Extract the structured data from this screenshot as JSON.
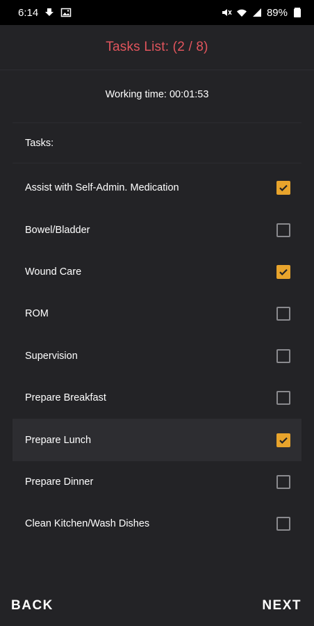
{
  "status_bar": {
    "time": "6:14",
    "battery": "89%",
    "icons_left": [
      "download-icon",
      "image-icon"
    ],
    "icons_right": [
      "mute-icon",
      "wifi-icon",
      "signal-icon",
      "battery-icon"
    ]
  },
  "header": {
    "title": "Tasks List: (2 / 8)",
    "title_color": "#e2555d"
  },
  "working_time": "Working time: 00:01:53",
  "tasks_label": "Tasks:",
  "accent_color": "#e8a42c",
  "tasks": [
    {
      "label": "Assist with Self-Admin. Medication",
      "checked": true
    },
    {
      "label": "Bowel/Bladder",
      "checked": false
    },
    {
      "label": "Wound Care",
      "checked": true
    },
    {
      "label": "ROM",
      "checked": false
    },
    {
      "label": "Supervision",
      "checked": false
    },
    {
      "label": "Prepare Breakfast",
      "checked": false
    },
    {
      "label": "Prepare Lunch",
      "checked": true,
      "highlighted": true
    },
    {
      "label": "Prepare Dinner",
      "checked": false
    },
    {
      "label": "Clean Kitchen/Wash Dishes",
      "checked": false
    }
  ],
  "nav": {
    "back_label": "BACK",
    "next_label": "NEXT"
  }
}
